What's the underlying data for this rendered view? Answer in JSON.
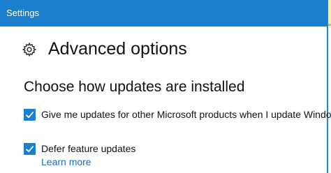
{
  "window": {
    "title": "Settings",
    "accent_color": "#1a7fcf"
  },
  "page": {
    "title": "Advanced options",
    "icon": "gear-icon"
  },
  "section": {
    "title": "Choose how updates are installed"
  },
  "options": [
    {
      "label": "Give me updates for other Microsoft products when I update Windows.",
      "checked": true
    },
    {
      "label": "Defer feature updates",
      "checked": true
    }
  ],
  "links": {
    "learn_more": "Learn more",
    "link_color": "#1a6ec2"
  }
}
